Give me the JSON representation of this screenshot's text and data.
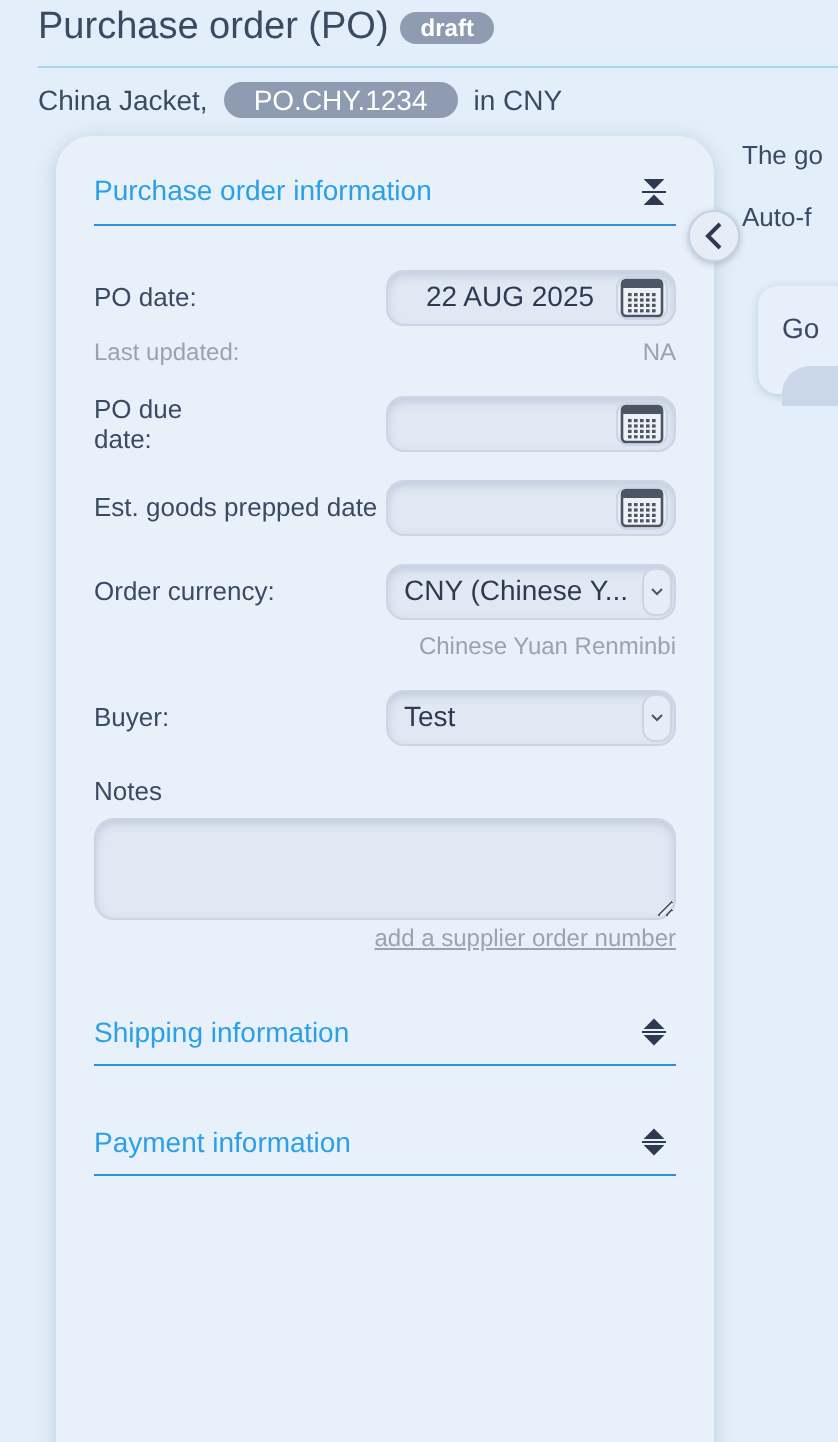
{
  "title": "Purchase order (PO)",
  "status_badge": "draft",
  "subtitle": {
    "supplier": "China Jacket,",
    "po_number": "PO.CHY.1234",
    "currency_note": "in CNY"
  },
  "sections": [
    {
      "title": "Purchase order information",
      "expanded": true,
      "fields": [
        {
          "kind": "date",
          "label": "PO date:",
          "value": "22 AUG 2025",
          "note_label": "Last updated:",
          "note_value": "NA"
        },
        {
          "kind": "date",
          "label": "PO due date:"
        },
        {
          "kind": "date",
          "label": "Est. goods prepped date"
        },
        {
          "kind": "select",
          "label": "Order currency:",
          "value": "CNY (Chinese Y...",
          "hint": "Chinese Yuan Renminbi"
        },
        {
          "kind": "select",
          "label": "Buyer:",
          "value": "Test"
        },
        {
          "kind": "textarea",
          "label": "Notes",
          "link": "add a supplier order number"
        }
      ]
    },
    {
      "title": "Shipping information",
      "expanded": false
    },
    {
      "title": "Payment information",
      "expanded": false
    }
  ],
  "side_texts": [
    "The go",
    "Auto-f"
  ],
  "side_card": {
    "title": "Go"
  }
}
